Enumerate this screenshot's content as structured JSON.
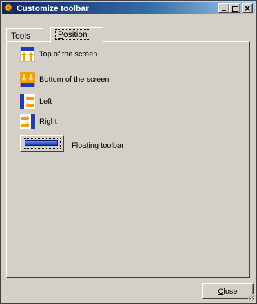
{
  "window": {
    "title": "Customize toolbar"
  },
  "title_buttons": {
    "minimize": "_",
    "maximize": "□",
    "close": "X"
  },
  "tabs": [
    {
      "label": "Tools",
      "active": false
    },
    {
      "label": "Position",
      "active": true,
      "mnemonic": "P"
    }
  ],
  "positions": [
    {
      "label": "Top of the screen",
      "icon": "toolbar-top-icon"
    },
    {
      "label": "Bottom of the screen",
      "icon": "toolbar-bottom-icon"
    },
    {
      "label": "Left",
      "icon": "toolbar-left-icon"
    },
    {
      "label": "Right",
      "icon": "toolbar-right-icon"
    }
  ],
  "floating": {
    "label": "Floating toolbar",
    "icon": "floating-toolbar-icon"
  },
  "buttons": {
    "close": "Close",
    "close_mnemonic": "C"
  },
  "colors": {
    "titlebar_start": "#0a246a",
    "titlebar_end": "#a6caf0",
    "face": "#d4d0c8",
    "bar_blue": "#1c3cb8",
    "arrow_orange": "#f5a000"
  }
}
